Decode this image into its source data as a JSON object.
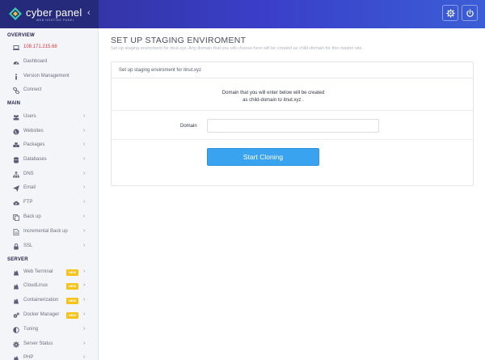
{
  "brand": {
    "name": "cyber panel",
    "tagline": "WEB HOSTING PANEL"
  },
  "header": {
    "settings_icon": "gear-icon",
    "power_icon": "power-icon"
  },
  "sidebar": {
    "overview_label": "OVERVIEW",
    "ip": "108.171.215.68",
    "overview_items": [
      {
        "label": "Dashboard",
        "icon": "dashboard-icon"
      },
      {
        "label": "Version Management",
        "icon": "info-icon"
      },
      {
        "label": "Connect",
        "icon": "link-icon"
      }
    ],
    "main_label": "MAIN",
    "main_items": [
      {
        "label": "Users",
        "icon": "users-icon"
      },
      {
        "label": "Websites",
        "icon": "globe-icon"
      },
      {
        "label": "Packages",
        "icon": "packages-icon"
      },
      {
        "label": "Databases",
        "icon": "database-icon"
      },
      {
        "label": "DNS",
        "icon": "sitemap-icon"
      },
      {
        "label": "Email",
        "icon": "paper-plane-icon"
      },
      {
        "label": "FTP",
        "icon": "cloud-upload-icon"
      },
      {
        "label": "Back up",
        "icon": "copy-icon"
      },
      {
        "label": "Incremental Back up",
        "icon": "file-icon"
      },
      {
        "label": "SSL",
        "icon": "lock-icon"
      }
    ],
    "server_label": "SERVER",
    "server_items": [
      {
        "label": "Web Terminal",
        "icon": "terminal-icon",
        "badge": "NEW"
      },
      {
        "label": "CloudLinux",
        "icon": "cloudlinux-icon",
        "badge": "NEW"
      },
      {
        "label": "Containerization",
        "icon": "container-icon",
        "badge": "NEW"
      },
      {
        "label": "Docker Manager",
        "icon": "cogs-icon",
        "badge": "NEW"
      },
      {
        "label": "Tuning",
        "icon": "adjust-icon"
      },
      {
        "label": "Server Status",
        "icon": "gear-icon"
      },
      {
        "label": "PHP",
        "icon": "php-icon"
      }
    ]
  },
  "main": {
    "title": "SET UP STAGING ENVIROMENT",
    "subtitle": "Set up staging enviroment for itnut.xyz.  Any domain that you will choose here will be created as child-domain for this master site.",
    "panel_title": "Set up staging enviroment for itnut.xyz",
    "info_line1": "Domain that you will enter below will be created",
    "info_line2": "as child-domain to itnut.xyz .",
    "domain_label": "Domain",
    "domain_value": "",
    "domain_placeholder": "",
    "button_label": "Start Cloning"
  },
  "colors": {
    "accent": "#3aa3f0",
    "topbar": "#3a3fc9",
    "badge": "#f6c31b",
    "ip": "#d9373d"
  }
}
